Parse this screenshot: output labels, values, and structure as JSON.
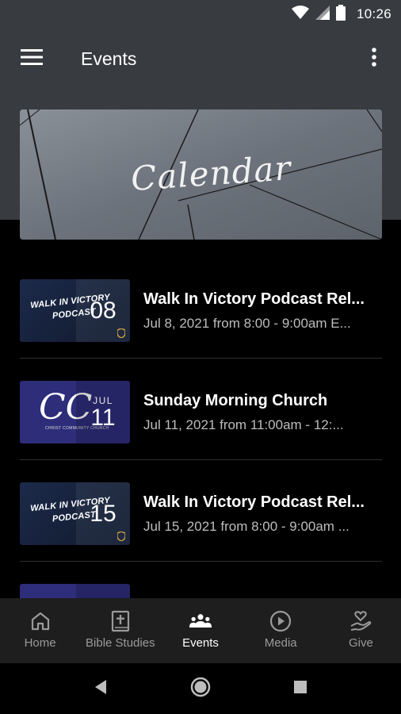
{
  "status_bar": {
    "time": "10:26"
  },
  "app_bar": {
    "title": "Events"
  },
  "banner": {
    "text": "Calendar"
  },
  "events": [
    {
      "thumb_type": "podcast",
      "thumb_text": "WALK IN VICTORY\nPODCAST",
      "month": "",
      "day": "08",
      "title": "Walk In Victory Podcast Rel...",
      "subtitle": "Jul 8, 2021 from 8:00 - 9:00am E..."
    },
    {
      "thumb_type": "church",
      "thumb_text": "CC",
      "thumb_sub": "CHRIST COMMUNITY CHURCH",
      "month": "JUL",
      "day": "11",
      "title": "Sunday Morning Church",
      "subtitle": "Jul 11, 2021 from 11:00am - 12:..."
    },
    {
      "thumb_type": "podcast",
      "thumb_text": "WALK IN VICTORY\nPODCAST",
      "month": "",
      "day": "15",
      "title": "Walk In Victory Podcast Rel...",
      "subtitle": "Jul 15, 2021 from 8:00 - 9:00am ..."
    },
    {
      "thumb_type": "church",
      "thumb_text": "",
      "month": "",
      "day": "",
      "title": "",
      "subtitle": ""
    }
  ],
  "bottom_nav": [
    {
      "label": "Home",
      "icon": "home-icon",
      "active": false
    },
    {
      "label": "Bible Studies",
      "icon": "bible-icon",
      "active": false
    },
    {
      "label": "Events",
      "icon": "people-icon",
      "active": true
    },
    {
      "label": "Media",
      "icon": "play-circle-icon",
      "active": false
    },
    {
      "label": "Give",
      "icon": "give-hand-heart-icon",
      "active": false
    }
  ],
  "colors": {
    "header_bg": "#383b40",
    "page_bg": "#000000",
    "nav_bg": "#1e1e1e",
    "inactive": "#9a9a9a",
    "active": "#ffffff",
    "church_thumb": "#2e2d7a"
  }
}
